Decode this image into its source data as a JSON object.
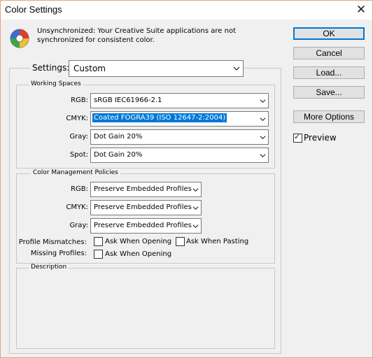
{
  "window": {
    "title": "Color Settings"
  },
  "message": {
    "line1": "Unsynchronized: Your Creative Suite applications are not",
    "line2": "synchronized for consistent color."
  },
  "buttons": {
    "ok": "OK",
    "cancel": "Cancel",
    "load": "Load...",
    "save": "Save...",
    "more": "More Options"
  },
  "preview": {
    "label": "Preview",
    "checked": true
  },
  "settings": {
    "label": "Settings:",
    "value": "Custom"
  },
  "working_spaces": {
    "title": "Working Spaces",
    "rgb_label": "RGB:",
    "rgb_value": "sRGB IEC61966-2.1",
    "cmyk_label": "CMYK:",
    "cmyk_value": "Coated FOGRA39 (ISO 12647-2:2004)",
    "gray_label": "Gray:",
    "gray_value": "Dot Gain 20%",
    "spot_label": "Spot:",
    "spot_value": "Dot Gain 20%"
  },
  "policies": {
    "title": "Color Management Policies",
    "rgb_label": "RGB:",
    "rgb_value": "Preserve Embedded Profiles",
    "cmyk_label": "CMYK:",
    "cmyk_value": "Preserve Embedded Profiles",
    "gray_label": "Gray:",
    "gray_value": "Preserve Embedded Profiles",
    "mismatch_label": "Profile Mismatches:",
    "ask_opening": "Ask When Opening",
    "ask_pasting": "Ask When Pasting",
    "missing_label": "Missing Profiles:",
    "ask_opening2": "Ask When Opening"
  },
  "description": {
    "title": "Description"
  },
  "colors": {
    "accent": "#0078d7",
    "window_border": "#e8a27a",
    "face": "#f0f0f0"
  },
  "icons": {
    "app": "color-wheel-icon",
    "close": "close-icon",
    "dropdown": "chevron-down-icon",
    "check": "checkmark-icon"
  }
}
